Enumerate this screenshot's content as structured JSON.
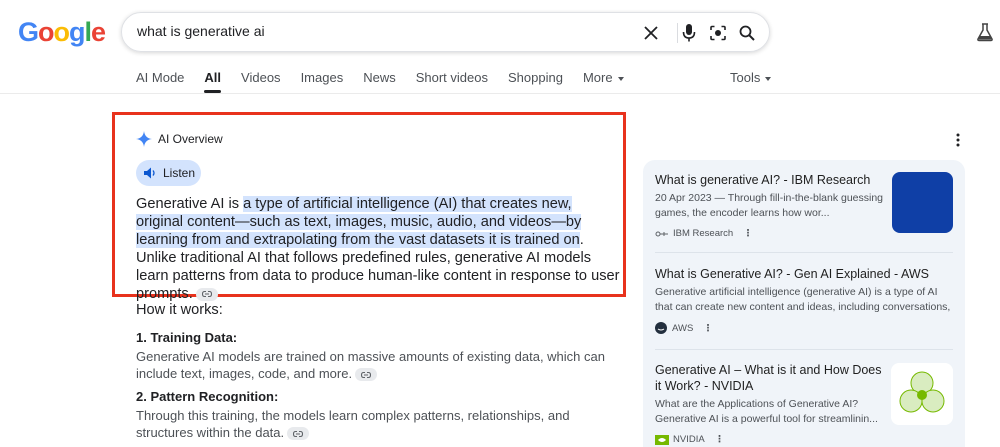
{
  "header": {
    "logo": [
      "G",
      "o",
      "o",
      "g",
      "l",
      "e"
    ],
    "logo_colors": [
      "#4285F4",
      "#EA4335",
      "#FBBC05",
      "#4285F4",
      "#34A853",
      "#EA4335"
    ],
    "search_query": "what is generative ai"
  },
  "tabs": [
    {
      "label": "AI Mode"
    },
    {
      "label": "All",
      "active": true
    },
    {
      "label": "Videos"
    },
    {
      "label": "Images"
    },
    {
      "label": "News"
    },
    {
      "label": "Short videos"
    },
    {
      "label": "Shopping"
    },
    {
      "label": "More",
      "dropdown": true
    }
  ],
  "tools_label": "Tools",
  "ai_overview": {
    "title": "AI Overview",
    "listen_label": "Listen",
    "intro": "Generative AI is ",
    "highlight": "a type of artificial intelligence (AI) that creates new, original content—such as text, images, music, audio, and videos—by learning from and extrapolating from the vast datasets it is trained on",
    "rest": ". Unlike traditional AI that follows predefined rules, generative AI models learn patterns from data to produce human-like content in response to user prompts.",
    "how_it_works": "How it works:",
    "steps": [
      {
        "title": "1. Training Data:",
        "body": "Generative AI models are trained on massive amounts of existing data, which can include text, images, code, and more."
      },
      {
        "title": "2. Pattern Recognition:",
        "body": "Through this training, the models learn complex patterns, relationships, and structures within the data."
      }
    ]
  },
  "results": [
    {
      "title": "What is generative AI? - IBM Research",
      "snippet": "20 Apr 2023 — Through fill-in-the-blank guessing games, the encoder learns how wor...",
      "source": "IBM Research"
    },
    {
      "title": "What is Generative AI? - Gen AI Explained - AWS",
      "snippet": "Generative artificial intelligence (generative AI) is a type of AI that can create new content and ideas, including conversations,",
      "source": "AWS"
    },
    {
      "title": "Generative AI – What is it and How Does it Work? - NVIDIA",
      "snippet": "What are the Applications of Generative AI? Generative AI is a powerful tool for streamlinin...",
      "source": "NVIDIA"
    }
  ],
  "colors": {
    "highlight": "#d3e3fd",
    "overview_border": "#e8321d",
    "panel_bg": "#f0f4f9",
    "ibm_thumb": "#0f3fa6",
    "nvidia_green": "#76b900"
  }
}
